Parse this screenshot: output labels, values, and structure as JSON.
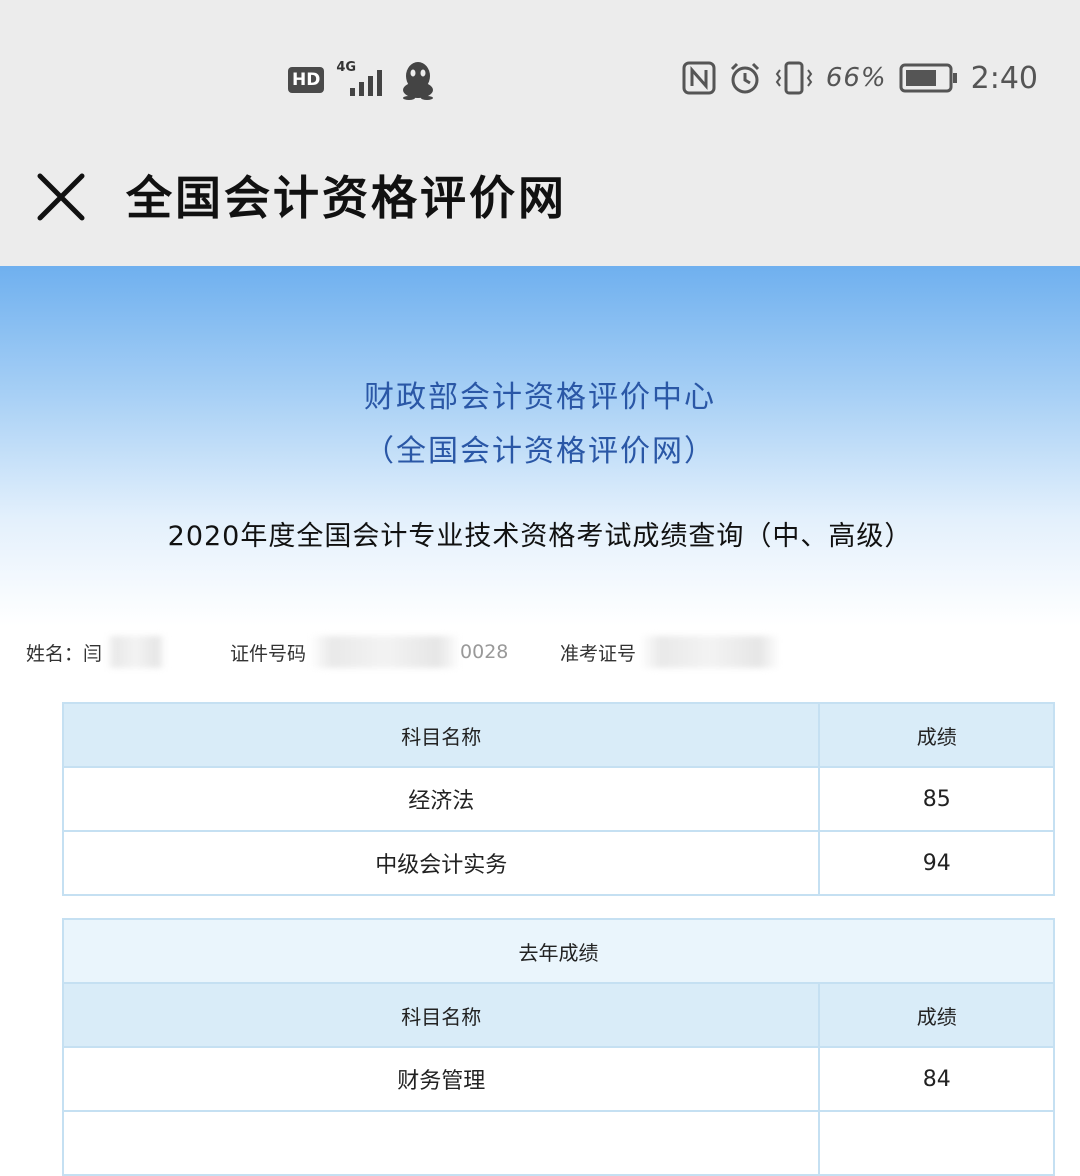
{
  "status_bar": {
    "hd_label": "HD",
    "network_label": "4G",
    "battery_percent": "66%",
    "time": "2:40",
    "icons": [
      "hd-icon",
      "signal-icon",
      "qq-icon",
      "nfc-icon",
      "alarm-icon",
      "vibrate-icon",
      "battery-icon"
    ]
  },
  "title_bar": {
    "title": "全国会计资格评价网"
  },
  "header": {
    "org_name": "财政部会计资格评价中心",
    "org_sub": "（全国会计资格评价网）",
    "exam_title": "2020年度全国会计专业技术资格考试成绩查询（中、高级）"
  },
  "candidate": {
    "name_label": "姓名：闫",
    "id_label": "证件号码",
    "id_tail": "0028",
    "ticket_label": "准考证号"
  },
  "current_scores": {
    "header_subject": "科目名称",
    "header_score": "成绩",
    "rows": [
      {
        "subject": "经济法",
        "score": "85"
      },
      {
        "subject": "中级会计实务",
        "score": "94"
      }
    ]
  },
  "last_year_scores": {
    "caption": "去年成绩",
    "header_subject": "科目名称",
    "header_score": "成绩",
    "rows": [
      {
        "subject": "财务管理",
        "score": "84"
      }
    ]
  },
  "colors": {
    "status_bg": "#ececec",
    "banner_top": "#6fb0ef",
    "org_text": "#2a57a6",
    "table_border": "#c5e0f2",
    "table_header_bg": "#d9ecf8"
  }
}
